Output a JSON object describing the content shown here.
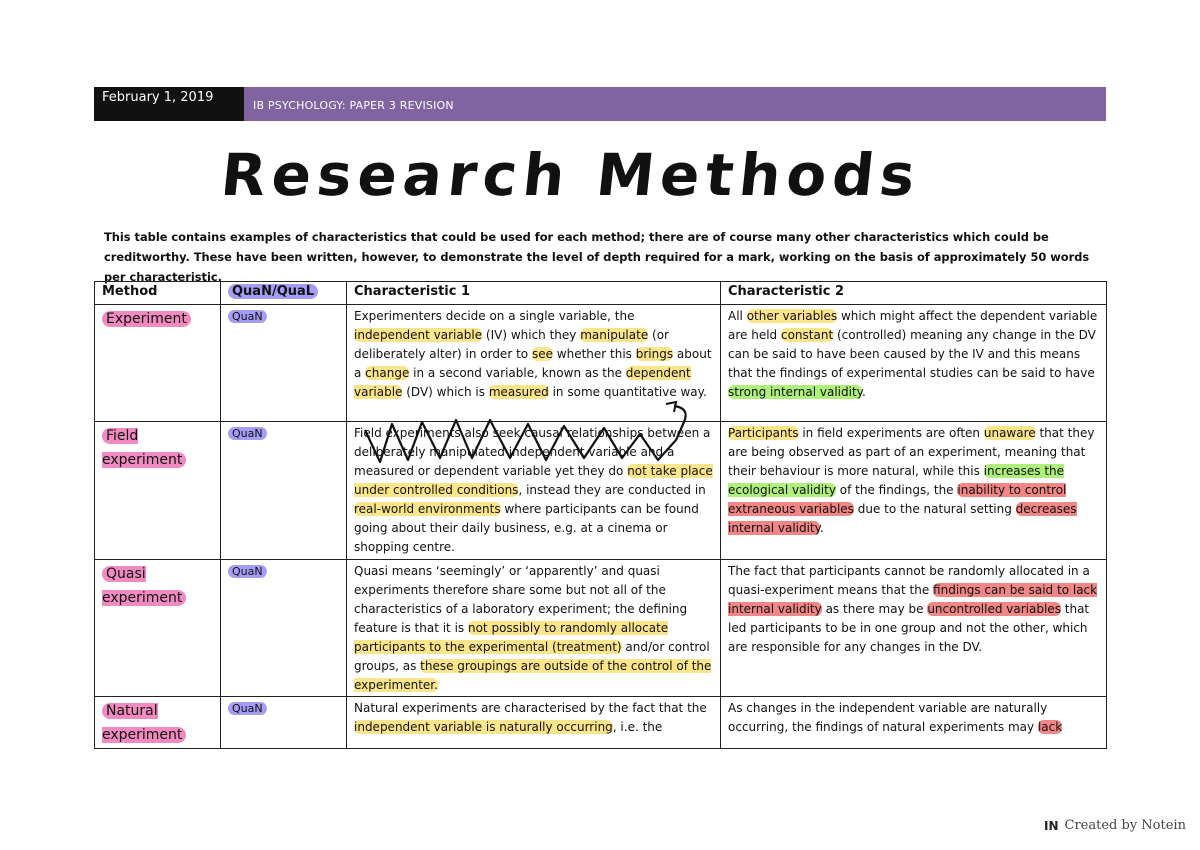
{
  "header": {
    "date": "February 1, 2019",
    "course": "IB PSYCHOLOGY: PAPER 3 REVISION"
  },
  "title": "Research Methods",
  "intro": "This table contains examples of characteristics that could be used for each method; there are of course many other characteristics which could be creditworthy. These have been written, however, to demonstrate the level of depth required for a mark, working on the basis of approximately 50 words per characteristic.",
  "table": {
    "headers": [
      "Method",
      "QuaN/QuaL",
      "Characteristic 1",
      "Characteristic 2"
    ],
    "rows": [
      {
        "method": "Experiment",
        "type": "QuaN",
        "c1": [
          [
            "Experimenters decide on a single variable, the ",
            ""
          ],
          [
            "independent variable",
            "y"
          ],
          [
            " (IV) which they ",
            ""
          ],
          [
            "manipulate",
            "y"
          ],
          [
            " (or deliberately alter) in order to ",
            ""
          ],
          [
            "see",
            "y"
          ],
          [
            " whether this ",
            ""
          ],
          [
            "brings",
            "y"
          ],
          [
            " about a ",
            ""
          ],
          [
            "change",
            "y"
          ],
          [
            " in a second variable, known as the ",
            ""
          ],
          [
            "dependent variable",
            "y"
          ],
          [
            " (DV) which is ",
            ""
          ],
          [
            "measured",
            "y"
          ],
          [
            " in some quantitative way.",
            ""
          ]
        ],
        "c2": [
          [
            "All ",
            ""
          ],
          [
            "other variables",
            "y"
          ],
          [
            " which might affect the dependent variable are held ",
            ""
          ],
          [
            "constant",
            "y"
          ],
          [
            " (controlled) meaning any change in the DV can be said to have been caused by the IV and this means that the findings of experimental studies can be said to have ",
            ""
          ],
          [
            "strong internal validity",
            "g"
          ],
          [
            ".",
            ""
          ]
        ]
      },
      {
        "method": "Field experiment",
        "type": "QuaN",
        "c1": [
          [
            "Field experiments also seek causal relationships between a deliberately manipulated independent variable and a measured or dependent variable yet they do ",
            ""
          ],
          [
            "not take place under controlled conditions",
            "y"
          ],
          [
            ", instead they are conducted in ",
            ""
          ],
          [
            "real-world environments",
            "y"
          ],
          [
            " where participants can be found going about their daily business, e.g. at a cinema or shopping centre.",
            ""
          ]
        ],
        "c2": [
          [
            "Participants",
            "y"
          ],
          [
            " in field experiments are often ",
            ""
          ],
          [
            "unaware",
            "y"
          ],
          [
            " that they are being observed as part of an experiment, meaning that their behaviour is more natural, while this ",
            ""
          ],
          [
            "increases the ecological validity",
            "g"
          ],
          [
            " of the findings, the ",
            ""
          ],
          [
            "inability to control extraneous variables",
            "r"
          ],
          [
            " due to the natural setting ",
            ""
          ],
          [
            "decreases internal validity",
            "r"
          ],
          [
            ".",
            ""
          ]
        ]
      },
      {
        "method": "Quasi experiment",
        "type": "QuaN",
        "c1": [
          [
            "Quasi means ‘seemingly’ or ‘apparently’ and quasi experiments therefore share some but not all of the characteristics of a laboratory experiment; the defining feature is that it is ",
            ""
          ],
          [
            "not possibly to randomly allocate participants to the experimental (treatment)",
            "y"
          ],
          [
            " and/or control groups, as ",
            ""
          ],
          [
            "these groupings are outside of the control of the experimenter.",
            "y"
          ]
        ],
        "c2": [
          [
            "The fact that participants cannot be randomly allocated in a quasi-experiment means that the ",
            ""
          ],
          [
            "findings can be said to lack internal validity",
            "r"
          ],
          [
            " as there may be ",
            ""
          ],
          [
            "uncontrolled variables",
            "r"
          ],
          [
            " that led participants to be in one group and not the other, which are responsible for any changes in the DV.",
            ""
          ]
        ]
      },
      {
        "method": "Natural experiment",
        "type": "QuaN",
        "c1": [
          [
            "Natural experiments are characterised by the fact that the ",
            ""
          ],
          [
            "independent variable is naturally occurring",
            "y"
          ],
          [
            ", i.e. the",
            ""
          ]
        ],
        "c2": [
          [
            "As changes in the independent variable are naturally occurring, the findings of natural experiments may ",
            ""
          ],
          [
            "lack",
            "r"
          ]
        ]
      }
    ]
  },
  "footer": {
    "logo": "IN",
    "text": "Created by Notein"
  }
}
